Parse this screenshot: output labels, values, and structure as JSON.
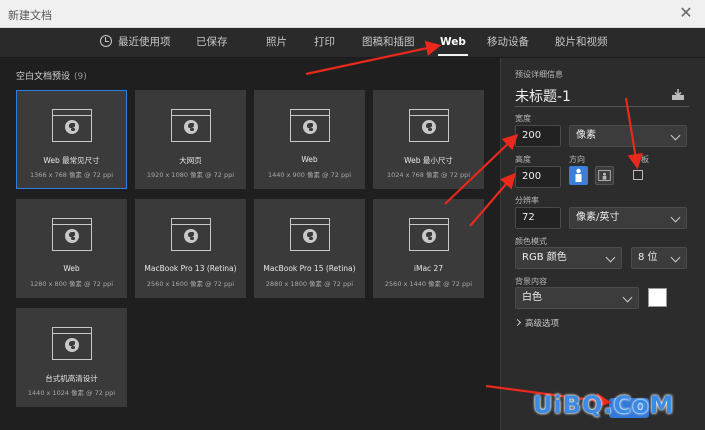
{
  "window": {
    "title": "新建文档",
    "close_glyph": "✕"
  },
  "tabs": [
    {
      "label": "最近使用项",
      "icon": "clock-icon"
    },
    {
      "label": "已保存"
    },
    {
      "label": "照片"
    },
    {
      "label": "打印"
    },
    {
      "label": "图稿和插图"
    },
    {
      "label": "Web",
      "active": true
    },
    {
      "label": "移动设备"
    },
    {
      "label": "胶片和视频"
    }
  ],
  "presets": {
    "title": "空白文档预设",
    "count": "(9)",
    "items": [
      {
        "name": "Web 最常见尺寸",
        "spec": "1366 x 768 像素 @ 72 ppi",
        "selected": true
      },
      {
        "name": "大网页",
        "spec": "1920 x 1080 像素 @ 72 ppi"
      },
      {
        "name": "Web",
        "spec": "1440 x 900 像素 @ 72 ppi"
      },
      {
        "name": "Web 最小尺寸",
        "spec": "1024 x 768 像素 @ 72 ppi"
      },
      {
        "name": "Web",
        "spec": "1280 x 800 像素 @ 72 ppi"
      },
      {
        "name": "MacBook Pro 13 (Retina)",
        "spec": "2560 x 1600 像素 @ 72 ppi"
      },
      {
        "name": "MacBook Pro 15 (Retina)",
        "spec": "2880 x 1800 像素 @ 72 ppi"
      },
      {
        "name": "iMac 27",
        "spec": "2560 x 1440 像素 @ 72 ppi"
      },
      {
        "name": "台式机高清设计",
        "spec": "1440 x 1024 像素 @ 72 ppi"
      }
    ]
  },
  "details": {
    "section_title": "预设详细信息",
    "doc_name": "未标题-1",
    "width_label": "宽度",
    "width_value": "200",
    "width_unit": "像素",
    "height_label": "高度",
    "height_value": "200",
    "orientation_label": "方向",
    "artboard_label": "板",
    "resolution_label": "分辨率",
    "resolution_value": "72",
    "resolution_unit": "像素/英寸",
    "color_mode_label": "颜色模式",
    "color_mode_value": "RGB 颜色",
    "bit_depth_value": "8 位",
    "background_label": "背景内容",
    "background_value": "白色",
    "background_color": "#ffffff",
    "advanced_label": "高级选项"
  },
  "watermark": "UiBQ.CoM",
  "colors": {
    "accent": "#3278d6",
    "selected_border": "#2f7fe0",
    "annotation_arrow": "#e8291c"
  }
}
